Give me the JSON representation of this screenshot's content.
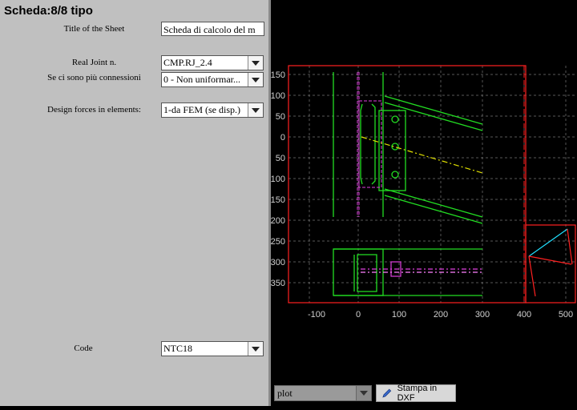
{
  "sheet": {
    "title": "Scheda:8/8 tipo"
  },
  "form": {
    "title_label": "Title of the Sheet",
    "title_value": "Scheda di calcolo del m",
    "joint_label": "Real Joint n.",
    "joint_value": "CMP.RJ_2.4",
    "conn_label": "Se ci sono più connessioni",
    "conn_value": "0 - Non uniformar...",
    "forces_label": "Design forces in elements:",
    "forces_value": "1-da FEM (se disp.)",
    "code_label": "Code",
    "code_value": "NTC18"
  },
  "plot_panel": {
    "selector_value": "plot",
    "dxf_button": "Stampa in DXF",
    "x_ticks": [
      "-100",
      "0",
      "100",
      "200",
      "300",
      "400",
      "500"
    ],
    "y_ticks": [
      "150",
      "100",
      "50",
      "0",
      "50",
      "100",
      "150",
      "200",
      "250",
      "300",
      "350"
    ],
    "colors": {
      "frame": "#ff2020",
      "green": "#22dd22",
      "magenta": "#e040e0",
      "yellow": "#e0e000",
      "cyan": "#20e0ff",
      "grid": "#777777"
    }
  }
}
